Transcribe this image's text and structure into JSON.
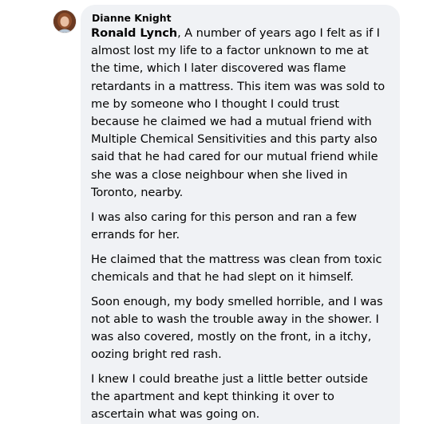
{
  "comment": {
    "author": "Dianne Knight",
    "mention": "Ronald Lynch",
    "first_paragraph_rest": ", A number of years ago I felt as if I almost lost my life to a factor unknown to me at the time, which I later discovered was flame retardants in a mattress. This item was was sold to me by someone who I thought I could trust because he claimed we had a mutual friend with Multiple Chemical Sensitivities and this party also said that he had cared for our mutual friend while she was a close neighbour when she lived in Toronto, nearby.",
    "paragraphs": [
      "I was also caring for this person and ran a few errands for her.",
      "He claimed that the mattress was clean from toxic chemicals and that he had slept on it himself.",
      "Soon enough, my body smelled horrible, and I was not able to wash the trouble away in the shower. I was also covered, mostly on the front, in a itchy, oozing bright red rash.",
      "I knew I could breathe just a little better outside the apartment and kept thinking it over to ascertain what was going on."
    ]
  }
}
